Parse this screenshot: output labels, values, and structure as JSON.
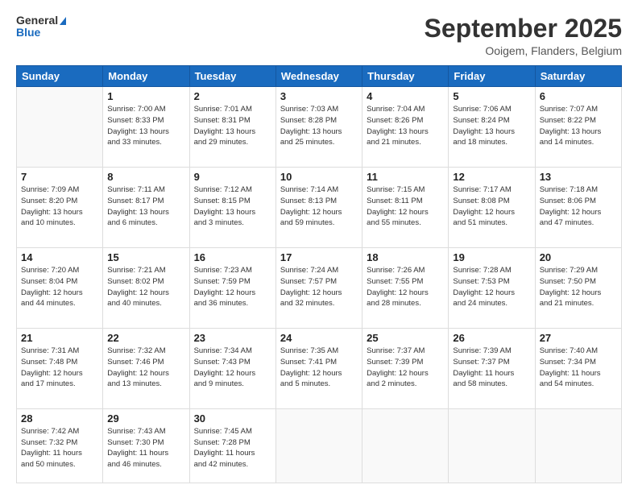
{
  "logo": {
    "line1": "General",
    "line2": "Blue"
  },
  "title": "September 2025",
  "location": "Ooigem, Flanders, Belgium",
  "days_of_week": [
    "Sunday",
    "Monday",
    "Tuesday",
    "Wednesday",
    "Thursday",
    "Friday",
    "Saturday"
  ],
  "weeks": [
    [
      {
        "day": "",
        "info": ""
      },
      {
        "day": "1",
        "info": "Sunrise: 7:00 AM\nSunset: 8:33 PM\nDaylight: 13 hours\nand 33 minutes."
      },
      {
        "day": "2",
        "info": "Sunrise: 7:01 AM\nSunset: 8:31 PM\nDaylight: 13 hours\nand 29 minutes."
      },
      {
        "day": "3",
        "info": "Sunrise: 7:03 AM\nSunset: 8:28 PM\nDaylight: 13 hours\nand 25 minutes."
      },
      {
        "day": "4",
        "info": "Sunrise: 7:04 AM\nSunset: 8:26 PM\nDaylight: 13 hours\nand 21 minutes."
      },
      {
        "day": "5",
        "info": "Sunrise: 7:06 AM\nSunset: 8:24 PM\nDaylight: 13 hours\nand 18 minutes."
      },
      {
        "day": "6",
        "info": "Sunrise: 7:07 AM\nSunset: 8:22 PM\nDaylight: 13 hours\nand 14 minutes."
      }
    ],
    [
      {
        "day": "7",
        "info": "Sunrise: 7:09 AM\nSunset: 8:20 PM\nDaylight: 13 hours\nand 10 minutes."
      },
      {
        "day": "8",
        "info": "Sunrise: 7:11 AM\nSunset: 8:17 PM\nDaylight: 13 hours\nand 6 minutes."
      },
      {
        "day": "9",
        "info": "Sunrise: 7:12 AM\nSunset: 8:15 PM\nDaylight: 13 hours\nand 3 minutes."
      },
      {
        "day": "10",
        "info": "Sunrise: 7:14 AM\nSunset: 8:13 PM\nDaylight: 12 hours\nand 59 minutes."
      },
      {
        "day": "11",
        "info": "Sunrise: 7:15 AM\nSunset: 8:11 PM\nDaylight: 12 hours\nand 55 minutes."
      },
      {
        "day": "12",
        "info": "Sunrise: 7:17 AM\nSunset: 8:08 PM\nDaylight: 12 hours\nand 51 minutes."
      },
      {
        "day": "13",
        "info": "Sunrise: 7:18 AM\nSunset: 8:06 PM\nDaylight: 12 hours\nand 47 minutes."
      }
    ],
    [
      {
        "day": "14",
        "info": "Sunrise: 7:20 AM\nSunset: 8:04 PM\nDaylight: 12 hours\nand 44 minutes."
      },
      {
        "day": "15",
        "info": "Sunrise: 7:21 AM\nSunset: 8:02 PM\nDaylight: 12 hours\nand 40 minutes."
      },
      {
        "day": "16",
        "info": "Sunrise: 7:23 AM\nSunset: 7:59 PM\nDaylight: 12 hours\nand 36 minutes."
      },
      {
        "day": "17",
        "info": "Sunrise: 7:24 AM\nSunset: 7:57 PM\nDaylight: 12 hours\nand 32 minutes."
      },
      {
        "day": "18",
        "info": "Sunrise: 7:26 AM\nSunset: 7:55 PM\nDaylight: 12 hours\nand 28 minutes."
      },
      {
        "day": "19",
        "info": "Sunrise: 7:28 AM\nSunset: 7:53 PM\nDaylight: 12 hours\nand 24 minutes."
      },
      {
        "day": "20",
        "info": "Sunrise: 7:29 AM\nSunset: 7:50 PM\nDaylight: 12 hours\nand 21 minutes."
      }
    ],
    [
      {
        "day": "21",
        "info": "Sunrise: 7:31 AM\nSunset: 7:48 PM\nDaylight: 12 hours\nand 17 minutes."
      },
      {
        "day": "22",
        "info": "Sunrise: 7:32 AM\nSunset: 7:46 PM\nDaylight: 12 hours\nand 13 minutes."
      },
      {
        "day": "23",
        "info": "Sunrise: 7:34 AM\nSunset: 7:43 PM\nDaylight: 12 hours\nand 9 minutes."
      },
      {
        "day": "24",
        "info": "Sunrise: 7:35 AM\nSunset: 7:41 PM\nDaylight: 12 hours\nand 5 minutes."
      },
      {
        "day": "25",
        "info": "Sunrise: 7:37 AM\nSunset: 7:39 PM\nDaylight: 12 hours\nand 2 minutes."
      },
      {
        "day": "26",
        "info": "Sunrise: 7:39 AM\nSunset: 7:37 PM\nDaylight: 11 hours\nand 58 minutes."
      },
      {
        "day": "27",
        "info": "Sunrise: 7:40 AM\nSunset: 7:34 PM\nDaylight: 11 hours\nand 54 minutes."
      }
    ],
    [
      {
        "day": "28",
        "info": "Sunrise: 7:42 AM\nSunset: 7:32 PM\nDaylight: 11 hours\nand 50 minutes."
      },
      {
        "day": "29",
        "info": "Sunrise: 7:43 AM\nSunset: 7:30 PM\nDaylight: 11 hours\nand 46 minutes."
      },
      {
        "day": "30",
        "info": "Sunrise: 7:45 AM\nSunset: 7:28 PM\nDaylight: 11 hours\nand 42 minutes."
      },
      {
        "day": "",
        "info": ""
      },
      {
        "day": "",
        "info": ""
      },
      {
        "day": "",
        "info": ""
      },
      {
        "day": "",
        "info": ""
      }
    ]
  ]
}
